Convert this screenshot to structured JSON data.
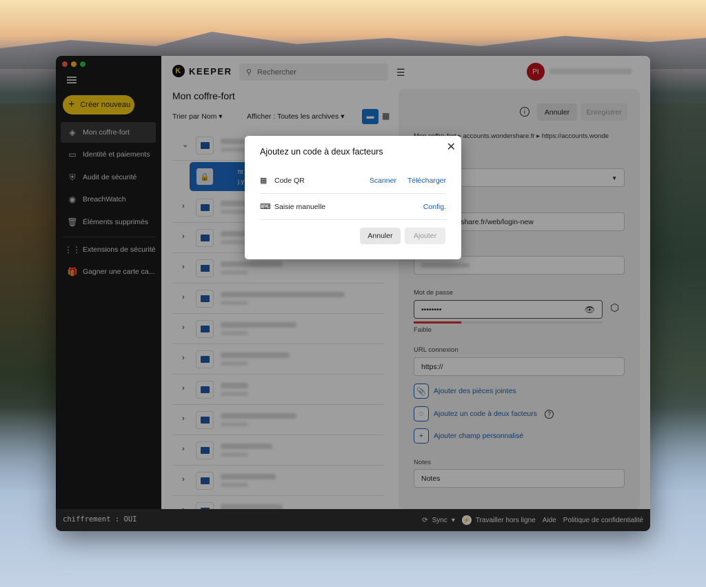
{
  "sidebar": {
    "create_label": "Créer nouveau",
    "items": [
      {
        "label": "Mon coffre-fort",
        "icon": "vault-icon"
      },
      {
        "label": "Identité et paiements",
        "icon": "card-icon"
      },
      {
        "label": "Audit de sécurité",
        "icon": "shield-icon"
      },
      {
        "label": "BreachWatch",
        "icon": "breachwatch-icon"
      },
      {
        "label": "Éléments supprimés",
        "icon": "trash-icon"
      },
      {
        "label": "Extensions de sécurité",
        "icon": "grid-icon"
      },
      {
        "label": "Gagner une carte ca...",
        "icon": "gift-icon"
      }
    ]
  },
  "header": {
    "logo_text": "KEEPER",
    "search_placeholder": "Rechercher",
    "avatar_initials": "PI"
  },
  "vault": {
    "title": "Mon coffre-fort",
    "sort_label": "Trier par Nom",
    "show_label": "Afficher : Toutes les archives",
    "selected_record_text": "ht",
    "selected_record_sub": "j.y"
  },
  "detail": {
    "cancel_label": "Annuler",
    "save_label": "Enregistrer",
    "breadcrumb": "Mon coffre-fort  ▸  accounts.wondershare.fr  ▸  https://accounts.wonde",
    "type_value": "on",
    "title_label": "e)",
    "title_value": "unts.wondershare.fr/web/login-new",
    "password_label": "Mot de passe",
    "password_value": "••••••••",
    "strength_label": "Faible",
    "strength_fraction": 0.25,
    "url_label": "URL connexion",
    "url_value": "https://",
    "add_attachments": "Ajouter des pièces jointes",
    "add_2fa": "Ajoutez un code à deux facteurs",
    "add_custom": "Ajouter champ personnalisé",
    "notes_label": "Notes",
    "notes_placeholder": "Notes"
  },
  "statusbar": {
    "encryption": "chiffrement : OUI",
    "sync": "Sync",
    "offline": "Travailler hors ligne",
    "help": "Aide",
    "privacy": "Politique de confidentialité"
  },
  "modal": {
    "title": "Ajoutez un code à deux facteurs",
    "qr_label": "Code QR",
    "scan_label": "Scanner",
    "upload_label": "Télécharger",
    "manual_label": "Saisie manuelle",
    "config_label": "Config.",
    "cancel_label": "Annuler",
    "add_label": "Ajouter"
  },
  "colors": {
    "accent": "#1976d2",
    "create_button": "#fdd017",
    "avatar": "#c4141c",
    "strength_weak": "#d32f2f"
  }
}
